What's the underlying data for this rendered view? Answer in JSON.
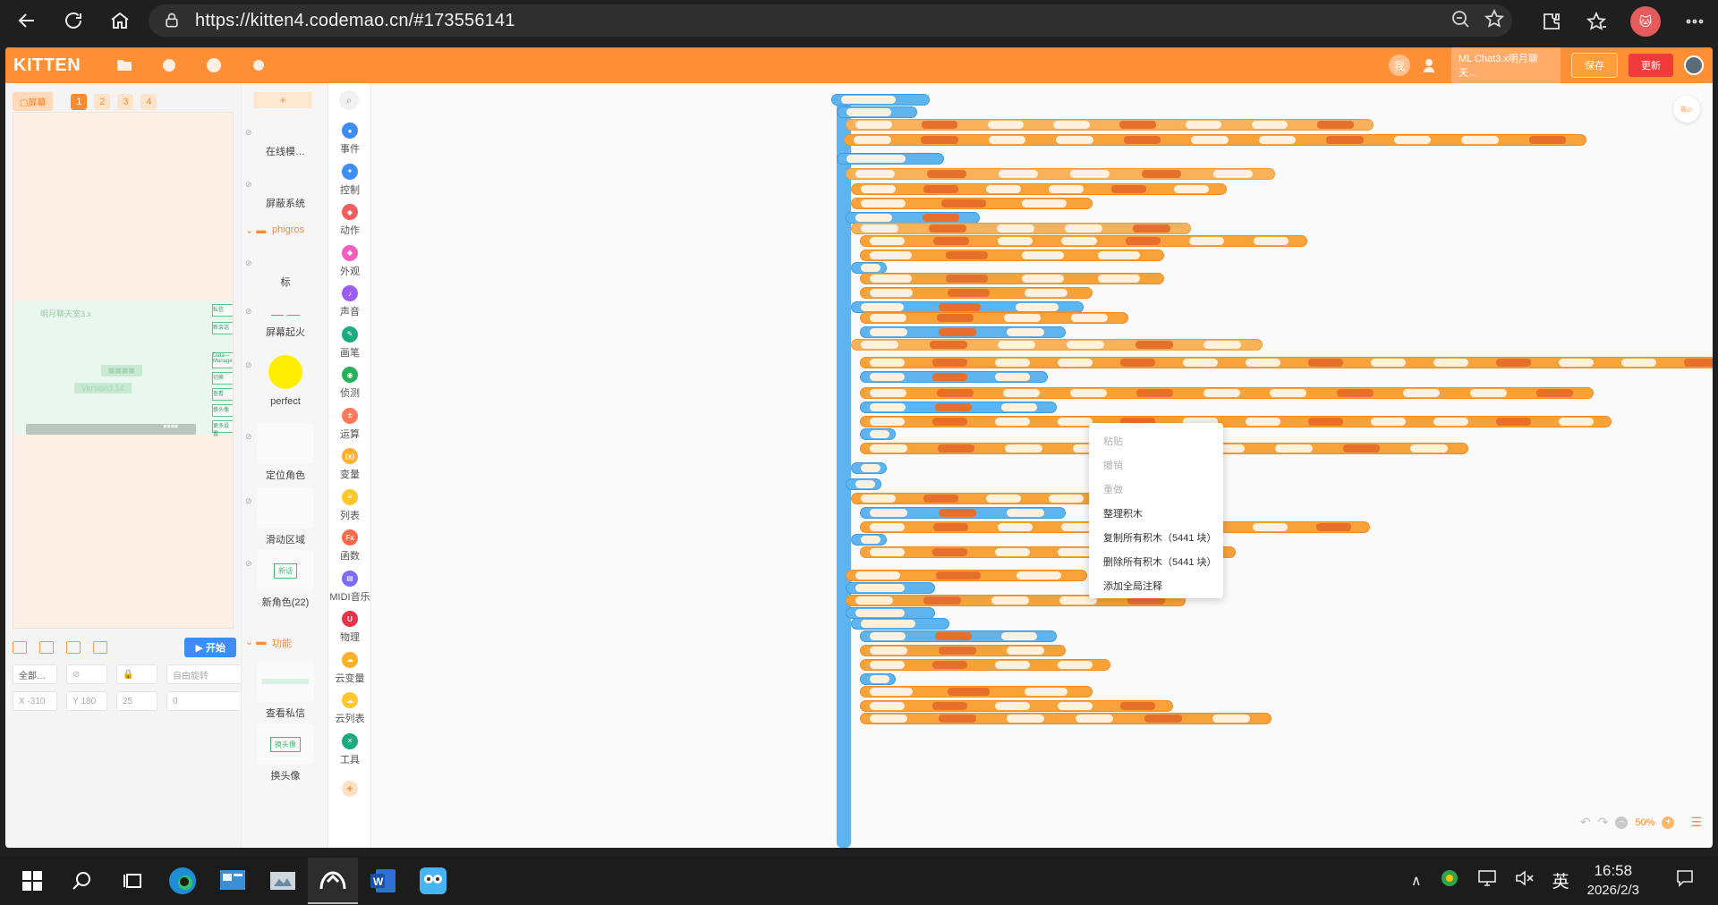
{
  "browser": {
    "url": "https://kitten4.codemao.cn/#173556141"
  },
  "topbar": {
    "brand": "KITTEN",
    "user_initial": "我",
    "chat_chip": "ML Chat3.x明月聊天…",
    "save_label": "保存",
    "update_label": "更新"
  },
  "stage": {
    "screen_label": "▢屏幕",
    "screen_tabs": [
      "1",
      "2",
      "3",
      "4"
    ],
    "title_text": "明月聊天室3.x",
    "pill_1": "◼◼◼◼",
    "pill_2": "Version3.14",
    "side_buttons": [
      "私信",
      "新会话",
      "Data—Manager",
      "切换",
      "",
      "查看",
      "换头像",
      "更多设置"
    ],
    "progress_label": "◼◼◼◼",
    "start_label": "▶ 开始",
    "all_label": "全部…",
    "rotate_label": "自由旋转",
    "x_label": "X",
    "x_value": "-310",
    "y_label": "Y",
    "y_value": "180",
    "size_value": "25",
    "angle_value": "0"
  },
  "sprites": {
    "add_label": "+",
    "items": [
      {
        "name": "在线模…"
      },
      {
        "name": "屏蔽系统"
      },
      {
        "name": "phigros"
      },
      {
        "name": "标"
      },
      {
        "name": "屏幕起火"
      },
      {
        "name": "perfect"
      },
      {
        "name": "定位角色"
      },
      {
        "name": "滑动区域"
      },
      {
        "name": "新角色(22)"
      },
      {
        "name": "功能"
      },
      {
        "name": "查看私信"
      },
      {
        "name": "换头像"
      }
    ],
    "thumb_badge_1": "新话",
    "thumb_badge_2": "换头像"
  },
  "categories": [
    {
      "label": "事件",
      "color": "#3d8df5",
      "glyph": "●"
    },
    {
      "label": "控制",
      "color": "#3d8df5",
      "glyph": "✦"
    },
    {
      "label": "动作",
      "color": "#f25d5d",
      "glyph": "◆"
    },
    {
      "label": "外观",
      "color": "#f25dbf",
      "glyph": "◆"
    },
    {
      "label": "声音",
      "color": "#9b5df2",
      "glyph": "♪"
    },
    {
      "label": "画笔",
      "color": "#1aab83",
      "glyph": "✎"
    },
    {
      "label": "侦测",
      "color": "#26b159",
      "glyph": "◉"
    },
    {
      "label": "运算",
      "color": "#ff7a5a",
      "glyph": "±"
    },
    {
      "label": "变量",
      "color": "#ffb02e",
      "glyph": "(x)"
    },
    {
      "label": "列表",
      "color": "#ffc72e",
      "glyph": "≡"
    },
    {
      "label": "函数",
      "color": "#ff6b4a",
      "glyph": "Fx"
    },
    {
      "label": "MIDI音乐",
      "color": "#7b6cf2",
      "glyph": "▤"
    },
    {
      "label": "物理",
      "color": "#e6334a",
      "glyph": "U"
    },
    {
      "label": "云变量",
      "color": "#ffb02e",
      "glyph": "☁"
    },
    {
      "label": "云列表",
      "color": "#ffc72e",
      "glyph": "☁"
    },
    {
      "label": "工具",
      "color": "#1aab83",
      "glyph": "✕"
    }
  ],
  "context_menu": {
    "items": [
      {
        "label": "粘贴",
        "enabled": false
      },
      {
        "label": "撤销",
        "enabled": false
      },
      {
        "label": "重做",
        "enabled": false
      },
      {
        "label": "整理积木",
        "enabled": true
      },
      {
        "label": "复制所有积木（5441 块）",
        "enabled": true
      },
      {
        "label": "删除所有积木（5441 块）",
        "enabled": true
      },
      {
        "label": "添加全局注释",
        "enabled": true
      }
    ]
  },
  "workspace": {
    "zoom": "50%",
    "corner_icon": "search-list-icon"
  },
  "taskbar": {
    "time": "16:58",
    "date": "2026/2/3",
    "ime": "英"
  }
}
